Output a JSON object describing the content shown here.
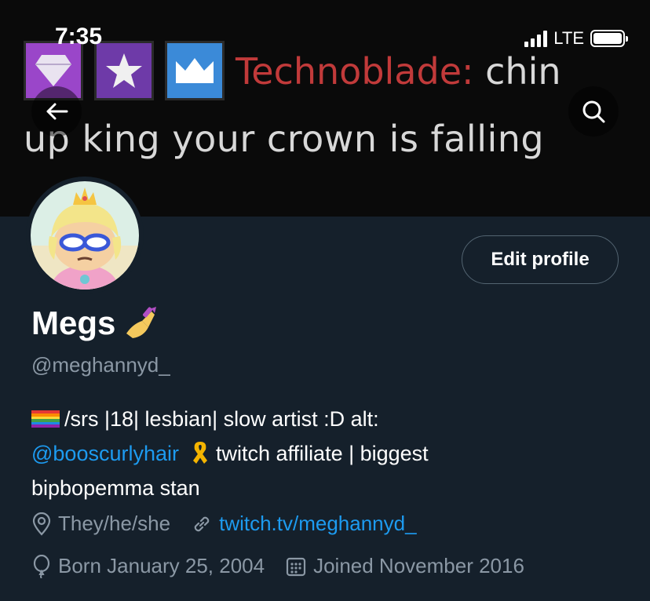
{
  "status_bar": {
    "time": "7:35",
    "network": "LTE",
    "signal_bars": 4,
    "battery_level": 1.0
  },
  "banner": {
    "line1_name": "Technoblade:",
    "line1_rest": " chin",
    "line2": "up king your crown is falling",
    "colors": {
      "name": "#c13a3a",
      "text": "#d8d8d8"
    },
    "badges": [
      "diamond-icon",
      "star-icon",
      "crown-icon"
    ]
  },
  "profile": {
    "display_name": "Megs",
    "name_emoji": "nail-polish-icon",
    "handle": "@meghannyd_",
    "edit_button": "Edit profile",
    "bio": {
      "line1": "/srs |18| lesbian| slow artist :D alt:",
      "mention": "@booscurlyhair",
      "line2_rest": " twitch affiliate | biggest",
      "line3": "bipbopemma stan"
    },
    "pronouns": "They/he/she",
    "website": "twitch.tv/meghannyd_",
    "birthday": "Born January 25, 2004",
    "joined": "Joined November 2016"
  },
  "colors": {
    "background": "#15202b",
    "accent": "#1d9bf0",
    "muted": "#8b98a5",
    "border": "#536471"
  }
}
